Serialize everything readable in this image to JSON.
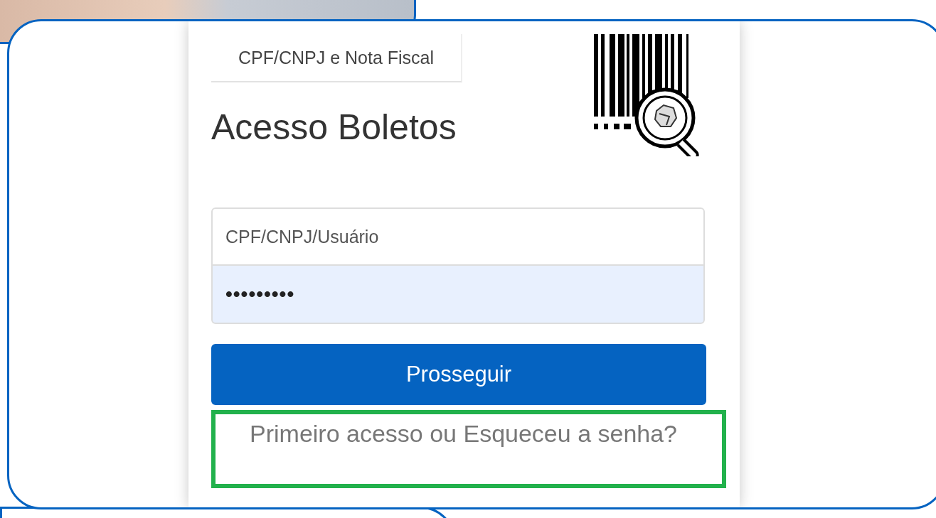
{
  "tab": {
    "label": "CPF/CNPJ e Nota Fiscal"
  },
  "heading": "Acesso Boletos",
  "fields": [
    {
      "placeholder": "CPF/CNPJ/Usuário",
      "kind": "text"
    },
    {
      "value": "•••••••••",
      "kind": "password"
    }
  ],
  "button": "Prosseguir",
  "link": "Primeiro acesso ou Esqueceu a senha?"
}
